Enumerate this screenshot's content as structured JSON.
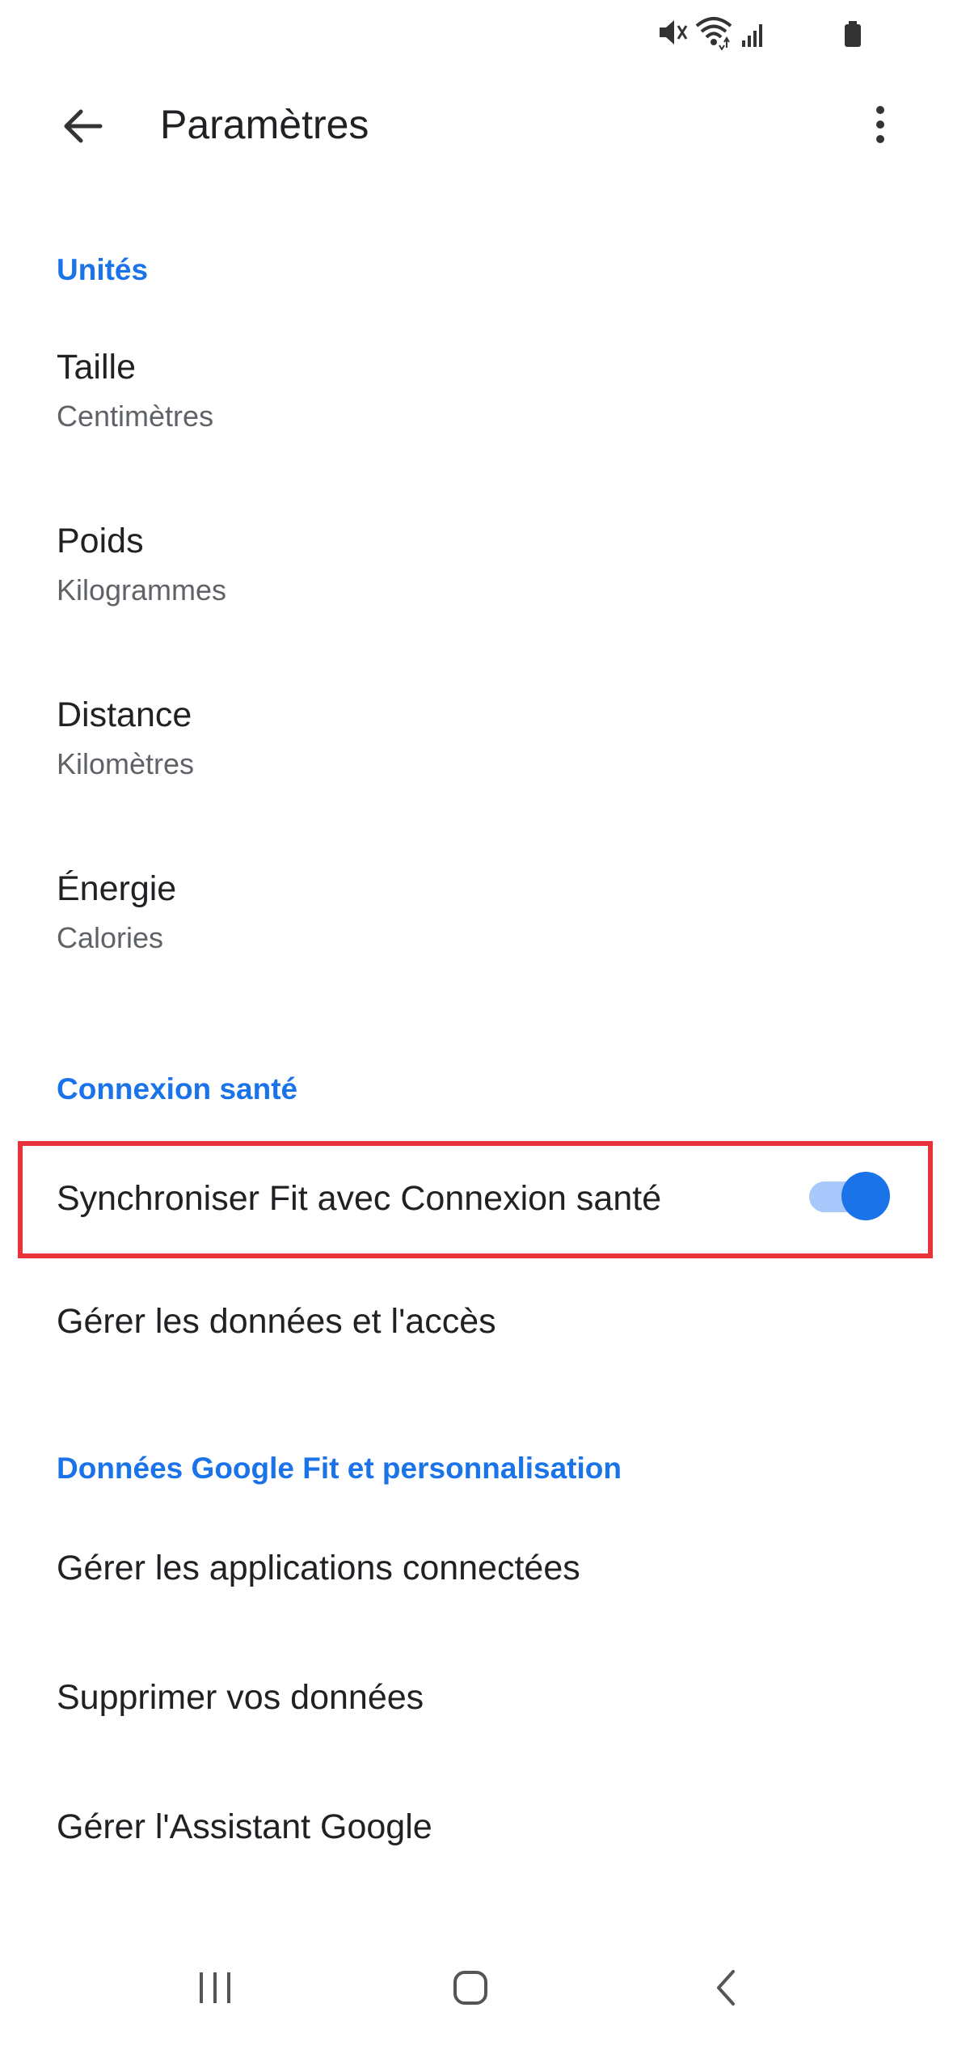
{
  "app_bar": {
    "title": "Paramètres"
  },
  "sections": {
    "units": {
      "header": "Unités",
      "items": [
        {
          "title": "Taille",
          "subtitle": "Centimètres"
        },
        {
          "title": "Poids",
          "subtitle": "Kilogrammes"
        },
        {
          "title": "Distance",
          "subtitle": "Kilomètres"
        },
        {
          "title": "Énergie",
          "subtitle": "Calories"
        }
      ]
    },
    "health_connect": {
      "header": "Connexion santé",
      "sync_label": "Synchroniser Fit avec Connexion santé",
      "sync_enabled": true,
      "manage_label": "Gérer les données et l'accès"
    },
    "google_fit": {
      "header": "Données Google Fit et personnalisation",
      "items": [
        {
          "title": "Gérer les applications connectées"
        },
        {
          "title": "Supprimer vos données"
        },
        {
          "title": "Gérer l'Assistant Google"
        }
      ]
    }
  },
  "icons": {
    "back": "arrow-left-icon",
    "more": "more-vert-icon",
    "status": [
      "mute-icon",
      "wifi-icon",
      "signal-icon",
      "battery-icon"
    ],
    "nav": [
      "recents-icon",
      "home-icon",
      "back-nav-icon"
    ]
  },
  "colors": {
    "accent": "#1a73e8",
    "highlight": "#e8333a",
    "toggle_track": "#a8c7fa"
  }
}
